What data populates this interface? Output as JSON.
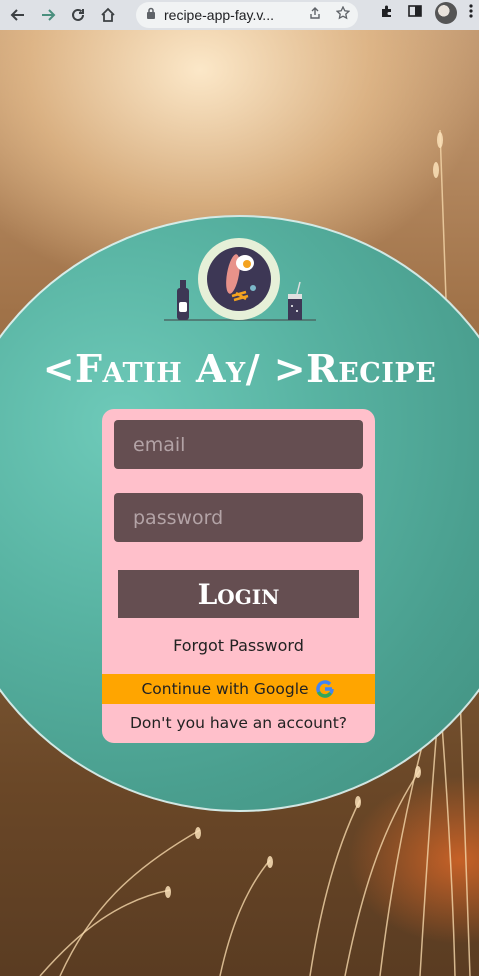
{
  "browser": {
    "url": "recipe-app-fay.v...",
    "icons": [
      "back-arrow-icon",
      "forward-arrow-icon",
      "reload-icon",
      "home-icon",
      "lock-icon",
      "share-icon",
      "star-icon",
      "extensions-icon",
      "side-panel-icon",
      "profile-avatar",
      "menu-icon"
    ]
  },
  "brand": {
    "title": "<Fatih Ay/ >Recipe"
  },
  "form": {
    "email_placeholder": "email",
    "password_placeholder": "password",
    "login_label": "Login",
    "forgot_label": "Forgot Password",
    "google_label": "Continue with Google",
    "signup_label": "Don't you have an account?"
  },
  "colors": {
    "card": "#ffc0cb",
    "input": "#654e51",
    "google_button": "#ffa500",
    "circle": "#58b3a2"
  }
}
